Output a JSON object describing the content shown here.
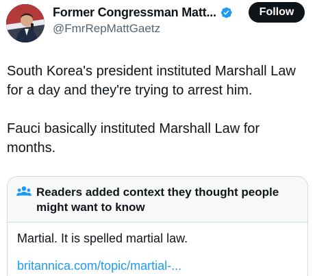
{
  "author": {
    "display_name": "Former Congressman Matt...",
    "handle": "@FmrRepMattGaetz",
    "avatar_icon": "profile-photo",
    "verified_icon": "verified-badge-icon"
  },
  "follow_button": {
    "label": "Follow"
  },
  "post": {
    "paragraphs": [
      "South Korea's president instituted Marshall Law for a day and they're trying to arrest him.",
      "Fauci basically instituted Marshall Law for months."
    ]
  },
  "community_note": {
    "icon": "people-icon",
    "title": "Readers added context they thought people might want to know",
    "text": "Martial.  It is spelled martial law.",
    "link": "britannica.com/topic/martial-..."
  },
  "colors": {
    "text": "#0f1419",
    "secondary_text": "#536471",
    "accent_blue": "#1d9bf0",
    "note_border": "#cfd9de",
    "note_header_bg": "#f7f9f9"
  }
}
